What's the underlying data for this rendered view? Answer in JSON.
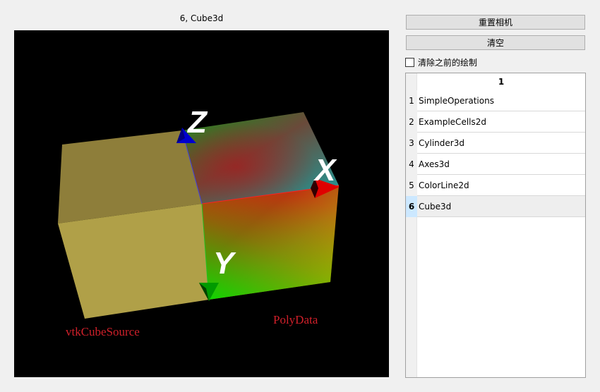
{
  "viewer": {
    "title": "6, Cube3d",
    "background": "#000000",
    "axes": {
      "x": "X",
      "y": "Y",
      "z": "Z"
    },
    "labels": {
      "left": "vtkCubeSource",
      "right": "PolyData"
    },
    "label_color": "#d0202a",
    "colors": {
      "x_arrow": "#e00000",
      "y_arrow": "#009a00",
      "z_arrow": "#0000d0",
      "left_box": "#b0a048"
    }
  },
  "controls": {
    "reset_camera": "重置相机",
    "clear": "清空",
    "clear_previous_label": "清除之前的绘制",
    "clear_previous_checked": false
  },
  "table": {
    "column_header": "1",
    "rows": [
      {
        "num": "1",
        "name": "SimpleOperations"
      },
      {
        "num": "2",
        "name": "ExampleCells2d"
      },
      {
        "num": "3",
        "name": "Cylinder3d"
      },
      {
        "num": "4",
        "name": "Axes3d"
      },
      {
        "num": "5",
        "name": "ColorLine2d"
      },
      {
        "num": "6",
        "name": "Cube3d"
      }
    ],
    "selected_row": "6"
  }
}
